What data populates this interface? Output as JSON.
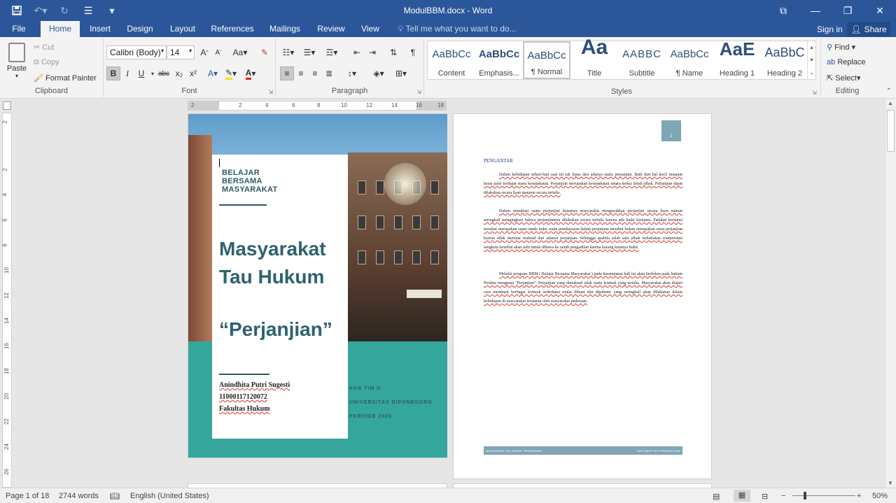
{
  "window": {
    "title": "ModulBBM.docx - Word"
  },
  "qat": {
    "save_icon": "save-icon",
    "undo_icon": "undo-icon",
    "redo_icon": "redo-icon"
  },
  "tabs": [
    {
      "label": "File"
    },
    {
      "label": "Home"
    },
    {
      "label": "Insert"
    },
    {
      "label": "Design"
    },
    {
      "label": "Layout"
    },
    {
      "label": "References"
    },
    {
      "label": "Mailings"
    },
    {
      "label": "Review"
    },
    {
      "label": "View"
    }
  ],
  "tell_me": "Tell me what you want to do...",
  "account": {
    "signin": "Sign in",
    "share": "Share"
  },
  "clipboard": {
    "paste": "Paste",
    "cut": "Cut",
    "copy": "Copy",
    "format_painter": "Format Painter",
    "label": "Clipboard"
  },
  "font": {
    "name": "Calibri (Body)",
    "size": "14",
    "label": "Font",
    "grow": "A",
    "shrink": "A",
    "case": "Aa",
    "bold": "B",
    "italic": "I",
    "underline": "U",
    "strike": "abc",
    "sub": "x₂",
    "sup": "x²",
    "color_a": "A"
  },
  "paragraph": {
    "label": "Paragraph"
  },
  "styles": {
    "label": "Styles",
    "items": [
      {
        "preview": "AaBbCc",
        "name": "Content"
      },
      {
        "preview": "AaBbCc",
        "name": "Emphasis..."
      },
      {
        "preview": "AaBbCc",
        "name": "¶ Normal"
      },
      {
        "preview": "Aa",
        "name": "Title"
      },
      {
        "preview": "AABBC",
        "name": "Subtitle"
      },
      {
        "preview": "AaBbCc",
        "name": "¶ Name"
      },
      {
        "preview": "AaE",
        "name": "Heading 1"
      },
      {
        "preview": "AaBbC",
        "name": "Heading 2"
      }
    ]
  },
  "editing": {
    "find": "Find",
    "replace": "Replace",
    "select": "Select",
    "label": "Editing"
  },
  "ruler": {
    "h_ticks": [
      "2",
      "2",
      "4",
      "6",
      "8",
      "10",
      "12",
      "14",
      "16",
      "18"
    ],
    "v_ticks": [
      "2",
      "2",
      "4",
      "6",
      "8",
      "10",
      "12",
      "14",
      "16",
      "18",
      "20",
      "22",
      "24",
      "26"
    ]
  },
  "cover": {
    "tag_lines": [
      "BELAJAR",
      "BERSAMA",
      "MASYARAKAT"
    ],
    "title": "Masyarakat Tau Hukum",
    "subtitle": "“Perjanjian”",
    "author": "Anindhita Putri Sugesti",
    "nim": "11000117120072",
    "faculty": "Fakultas Hukum",
    "right_lines": [
      "KKN TIM II",
      "UNIVERSITAS DIPONEGORO",
      "PERIODE 2020"
    ]
  },
  "page2": {
    "page_number": "2",
    "heading": "PENGANTAR",
    "paragraphs": [
      "Dalam kehidupan sehari-hari saat ini tak lepas dari adanya suatu perjanjian. Baik dari hal kecil maupun besar pasti terdapat suatu kesepakatan. Perjanjian merupakan kesepakatan antara kedua belah pihak. Perjanjian dapat dilakukan secara lisan maupun secara tertulis.",
      "Dalam membuat suatu perjanjian biasanya masyarakat mengesahkan perjanjian secara lisan namun seringkali mengingkari bahwa perjanjiannya dilakukan secara tertulis karena ada bukti kwitansi. Padahal kwitansi tersebut merupakan suatu tanda bukti suatu pembayaran dalam perjanjian tersebut bukan merupakan surat perjanjian karena tidak memuat maksud dari adanya perjanjian. Sehingga apabila salah satu pihak melakukan wanprestasi sengketa tersebut akan sulit untuk dibawa ke ranah pengadilan karena kurang kuatnya bukti.",
      "Melalui program BBM ( Belajar Bersama Masyarakat ) pada kesempatan kali ini akan berfokus pada hukum Perdata mengenai \"Perjanjian\". Perjanjian yang dimaksud ialah suatu kontrak yang tertulis. Masyarakat akan diajari cara membuat berbagai kontrak sederhana mulai dibuat dan dipahami yang seringkali akan dilakukan dalam kehidupan di masyarakat terutama oleh masyarakat pedesaan."
    ],
    "footer_left": "MASYARAKAT TAU HUKUM: “PERJANJIAN”",
    "footer_right": "KKN UNDIP TIM II PERIODE 2020"
  },
  "status": {
    "page": "Page 1 of 18",
    "words": "2744 words",
    "language": "English (United States)",
    "zoom": "50%",
    "zoom_level": 50
  }
}
